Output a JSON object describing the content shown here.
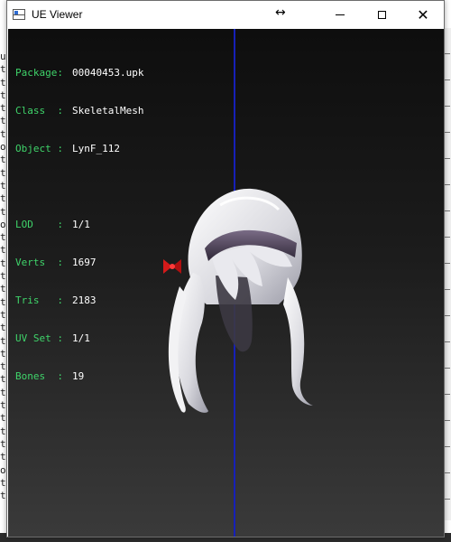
{
  "window": {
    "title": "UE Viewer"
  },
  "info": {
    "package": {
      "label": "Package:",
      "value": "00040453.upk"
    },
    "class": {
      "label": "Class  :",
      "value": "SkeletalMesh"
    },
    "object": {
      "label": "Object :",
      "value": "LynF_112"
    },
    "lod": {
      "label": "LOD    :",
      "value": "1/1"
    },
    "verts": {
      "label": "Verts  :",
      "value": "1697"
    },
    "tris": {
      "label": "Tris   :",
      "value": "2183"
    },
    "uvset": {
      "label": "UV Set :",
      "value": "1/1"
    },
    "bones": {
      "label": "Bones  :",
      "value": "19"
    }
  },
  "background_console": {
    "left_chars": [
      "u",
      "t",
      "t",
      "t",
      "t",
      "t",
      "t",
      "o",
      "t",
      "t",
      "t",
      "t",
      "t",
      "o",
      "t",
      "t",
      "t",
      "t",
      "t",
      "t",
      "t",
      "t",
      "t",
      "t",
      "t",
      "t",
      "t",
      "t",
      "t",
      "t",
      "t",
      "t",
      "o",
      "t",
      "t"
    ]
  },
  "colors": {
    "label": "#3fd46a",
    "value": "#ffffff",
    "axis": "#1620b8",
    "bow": "#d41a1a"
  }
}
